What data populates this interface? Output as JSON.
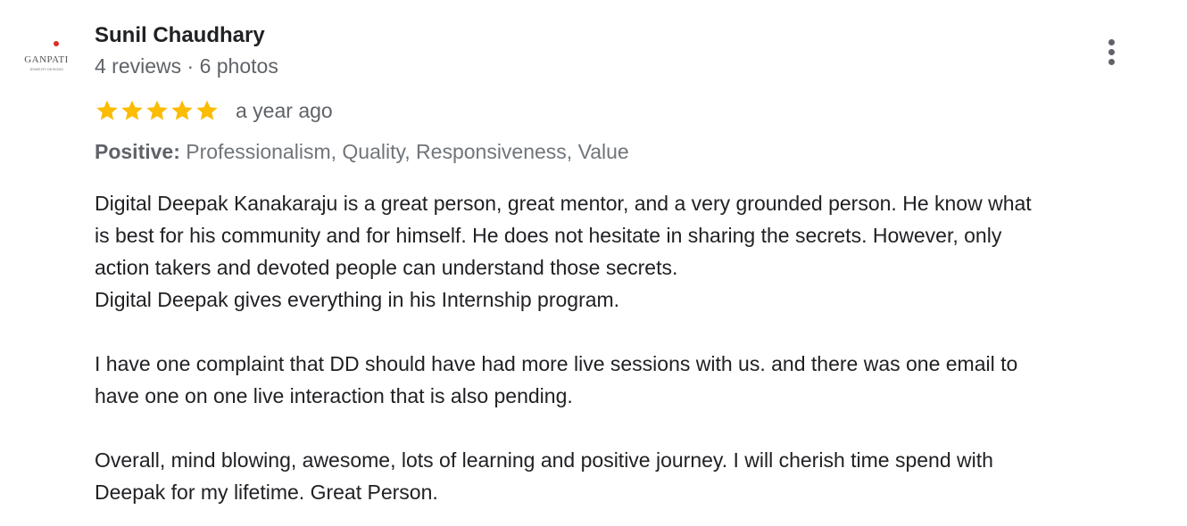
{
  "reviewer": {
    "name": "Sunil Chaudhary",
    "meta": "4 reviews · 6 photos",
    "avatar_text": "GANPATI",
    "avatar_subtext": "JEWELRY DESIGNS"
  },
  "review": {
    "rating": 5,
    "rating_max": 5,
    "time": "a year ago",
    "positive_label": "Positive:",
    "positive_values": "Professionalism, Quality, Responsiveness, Value",
    "lines": [
      "Digital Deepak Kanakaraju is a great person, great mentor, and a very grounded person. He know what",
      "is best for his community and for himself. He does not hesitate in sharing the secrets. However, only",
      "action takers and devoted people can understand those secrets.",
      "Digital Deepak gives everything in his Internship program.",
      "",
      "I have one complaint that DD should have had more live sessions with us. and there was one email to",
      "have one on one live interaction that is also pending.",
      "",
      "Overall, mind blowing, awesome, lots of learning and positive journey. I will cherish time spend with",
      "Deepak for my lifetime. Great Person."
    ]
  },
  "icons": {
    "more": "more-vert-icon",
    "star": "star-icon"
  },
  "colors": {
    "star": "#fbbc04",
    "secondary_text": "#5f6368",
    "primary_text": "#202124",
    "avatar_dot": "#d93025"
  }
}
